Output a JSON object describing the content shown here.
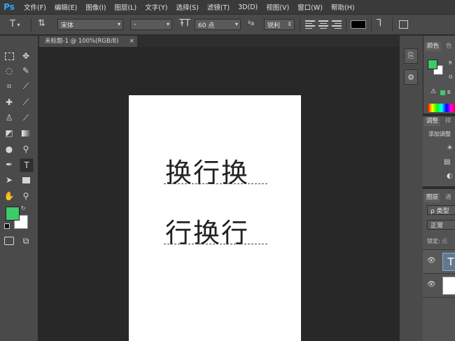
{
  "app": {
    "logo_text": "Ps"
  },
  "menu": [
    "文件(F)",
    "编辑(E)",
    "图像(I)",
    "图层(L)",
    "文字(Y)",
    "选择(S)",
    "滤镜(T)",
    "3D(D)",
    "视图(V)",
    "窗口(W)",
    "帮助(H)"
  ],
  "options": {
    "font_family": "宋体",
    "font_style": "-",
    "font_size": "60 点",
    "antialias": "锐利",
    "antialias_icon_text": "ªa"
  },
  "tab": {
    "title": "未标题-1 @ 100%(RGB/8)",
    "close": "×"
  },
  "document": {
    "line1": "换行换",
    "line2": "行换行"
  },
  "panels": {
    "color_tab": "颜色",
    "color_tab2": "色",
    "color_channel_r": "R",
    "color_channel_g": "G",
    "adjust_tab": "调整",
    "adjust_tab2": "样",
    "adjust_hint": "添加调整",
    "layers_tab": "图层",
    "layers_tab2": "通",
    "layer_kind": "ρ 类型",
    "blend_mode": "正常",
    "lock_label": "锁定:",
    "lock_icon_text": "巡",
    "layer_text_thumb": "T"
  },
  "colors": {
    "foreground": "#3ec96b",
    "background": "#ffffff",
    "option_color": "#000000",
    "logo": "#31a8ff"
  }
}
